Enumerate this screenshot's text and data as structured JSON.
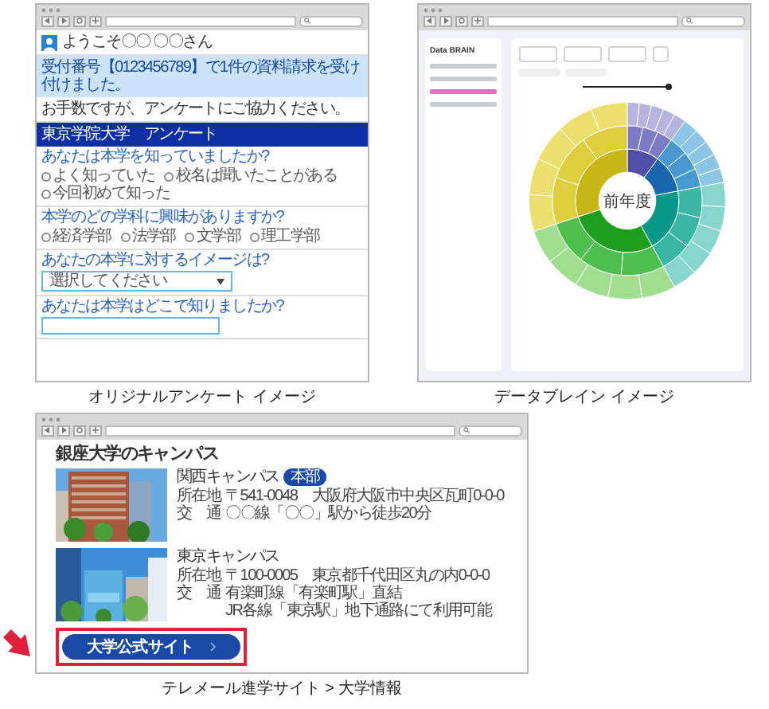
{
  "panels": [
    {
      "kind": "survey",
      "caption": "オリジナルアンケート イメージ",
      "welcome": "ようこそ〇〇 〇〇さん",
      "notice": "受付番号【0123456789】で1件の資料請求を受け付けました。",
      "request": "お手数ですが、アンケートにご協力ください。",
      "header": "東京学院大学　アンケート",
      "questions": [
        {
          "kind": "radio",
          "label": "あなたは本学を知っていましたか?",
          "options": [
            {
              "label": "よく知っていた",
              "selected": false
            },
            {
              "label": "校名は聞いたことがある",
              "selected": false
            },
            {
              "label": "今回初めて知った",
              "selected": false
            }
          ]
        },
        {
          "kind": "radio",
          "label": "本学のどの学科に興味がありますか?",
          "options": [
            {
              "label": "経済学部",
              "selected": false
            },
            {
              "label": "法学部",
              "selected": false
            },
            {
              "label": "文学部",
              "selected": false
            },
            {
              "label": "理工学部",
              "selected": false
            }
          ]
        },
        {
          "kind": "select",
          "label": "あなたの本学に対するイメージは?",
          "placeholder": "選択してください"
        },
        {
          "kind": "text",
          "label": "あなたは本学はどこで知りましたか?"
        }
      ]
    },
    {
      "kind": "dashboard",
      "caption": "データブレイン イメージ",
      "brand": "Data BRAIN",
      "nav_items": [
        {
          "selected": false
        },
        {
          "selected": false
        },
        {
          "selected": true
        },
        {
          "selected": false
        }
      ],
      "slider": {
        "level": 1
      },
      "center_label": "前年度"
    },
    {
      "kind": "campus",
      "caption": "テレメール進学サイト > 大学情報",
      "title": "銀座大学のキャンパス",
      "campuses": [
        {
          "name": "関西キャンパス",
          "badge": "本部",
          "address_label": "所在地",
          "address": "〒541-0048　大阪府大阪市中央区瓦町0-0-0",
          "access_label": "交　通",
          "access": [
            "〇〇線「〇〇」駅から徒歩20分"
          ]
        },
        {
          "name": "東京キャンパス",
          "address_label": "所在地",
          "address": "〒100-0005　東京都千代田区丸の内0-0-0",
          "access_label": "交　通",
          "access": [
            "有楽町線「有楽町駅」直結",
            "JR各線「東京駅」地下通路にて利用可能"
          ]
        }
      ],
      "button": "大学公式サイト",
      "highlighted": true
    }
  ]
}
